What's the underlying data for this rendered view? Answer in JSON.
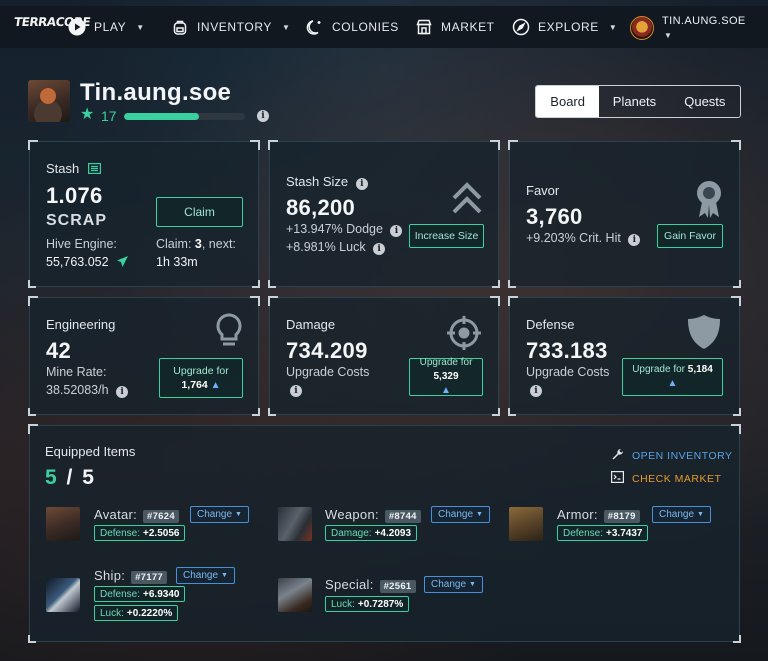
{
  "nav": {
    "logo": "TERRACORE",
    "play": "PLAY",
    "inventory": "INVENTORY",
    "colonies": "COLONIES",
    "market": "MARKET",
    "explore": "EXPLORE",
    "username": "TIN.AUNG.SOE"
  },
  "profile": {
    "name": "Tin.aung.soe",
    "level": "17",
    "xp_progress": 0.62
  },
  "tabs": [
    "Board",
    "Planets",
    "Quests"
  ],
  "stash": {
    "title": "Stash",
    "amount": "1.076",
    "unit": "SCRAP",
    "hive_label": "Hive Engine:",
    "hive_value": "55,763.052",
    "claim_button": "Claim",
    "claim_prefix": "Claim: ",
    "claim_count": "3",
    "claim_next": ", next:",
    "claim_time": "1h 33m"
  },
  "stash_size": {
    "title": "Stash Size",
    "value": "86,200",
    "dodge": "+13.947% Dodge",
    "luck": "+8.981% Luck",
    "button": "Increase Size"
  },
  "favor": {
    "title": "Favor",
    "value": "3,760",
    "crit": "+9.203% Crit. Hit",
    "button": "Gain Favor"
  },
  "engineering": {
    "title": "Engineering",
    "value": "42",
    "mine_label": "Mine Rate:",
    "mine_value": "38.52083/h",
    "button_label": "Upgrade for",
    "button_cost": "1,764"
  },
  "damage": {
    "title": "Damage",
    "value": "734.209",
    "costs_label": "Upgrade Costs",
    "button_label": "Upgrade for",
    "button_cost": "5,329"
  },
  "defense": {
    "title": "Defense",
    "value": "733.183",
    "costs_label": "Upgrade Costs",
    "button_label": "Upgrade for",
    "button_cost": "5,184"
  },
  "equipped": {
    "title": "Equipped Items",
    "current": "5",
    "separator": " / ",
    "total": "5",
    "open_inventory": "OPEN INVENTORY",
    "check_market": "CHECK MARKET",
    "change_label": "Change",
    "items": [
      {
        "label": "Avatar:",
        "id": "#7624",
        "stats": [
          {
            "k": "Defense:",
            "v": "+2.5056"
          }
        ]
      },
      {
        "label": "Weapon:",
        "id": "#8744",
        "stats": [
          {
            "k": "Damage:",
            "v": "+4.2093"
          }
        ]
      },
      {
        "label": "Armor:",
        "id": "#8179",
        "stats": [
          {
            "k": "Defense:",
            "v": "+3.7437"
          }
        ]
      },
      {
        "label": "Ship:",
        "id": "#7177",
        "stats": [
          {
            "k": "Defense:",
            "v": "+6.9340"
          },
          {
            "k": "Luck:",
            "v": "+0.2220%"
          }
        ]
      },
      {
        "label": "Special:",
        "id": "#2561",
        "stats": [
          {
            "k": "Luck:",
            "v": "+0.7287%"
          }
        ]
      }
    ]
  },
  "colors": {
    "accent": "#3ad0a0",
    "link_blue": "#5aa2e6",
    "link_orange": "#e59a2e"
  }
}
